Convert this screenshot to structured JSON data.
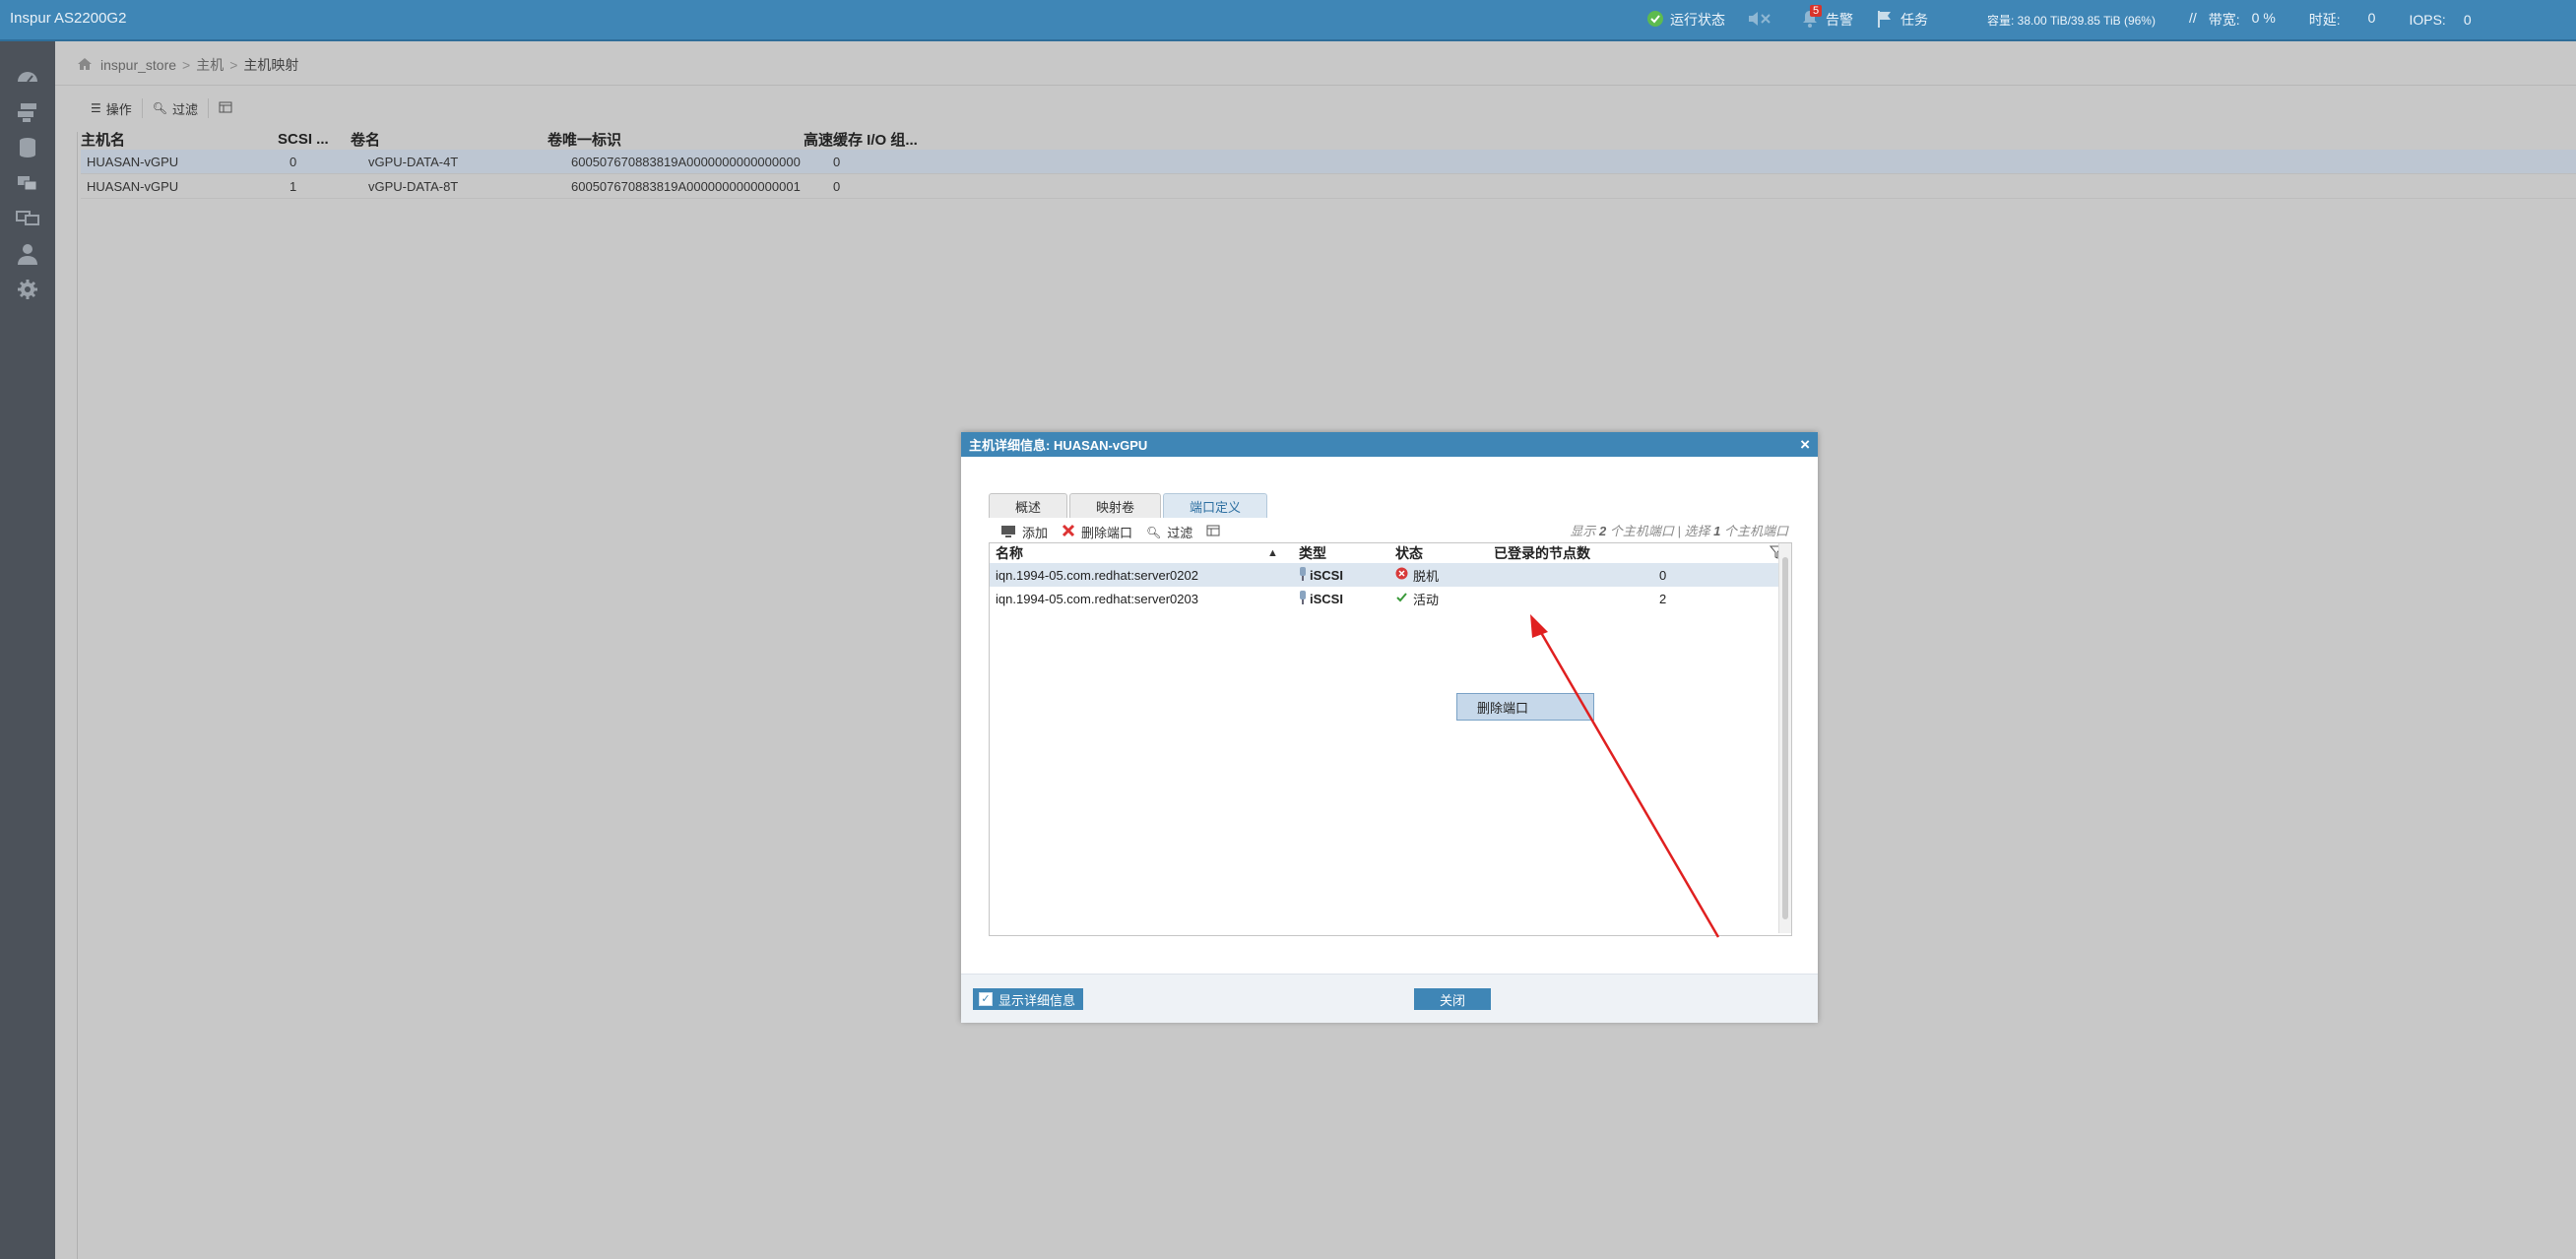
{
  "app": {
    "title": "Inspur AS2200G2"
  },
  "topbar": {
    "run_status": "运行状态",
    "alarm_count": "5",
    "alarm_label": "告警",
    "task_label": "任务",
    "capacity": "容量: 38.00 TiB/39.85 TiB (96%)",
    "bandwidth_label": "带宽:",
    "bandwidth_value": "0 %",
    "latency_label": "时延:",
    "latency_value": "0",
    "iops_label": "IOPS:",
    "iops_value": "0"
  },
  "breadcrumb": [
    "inspur_store",
    "主机",
    "主机映射"
  ],
  "toolbar": {
    "actions": "操作",
    "filter": "过滤"
  },
  "grid": {
    "headers": [
      "主机名",
      "SCSI ...",
      "卷名",
      "卷唯一标识",
      "高速缓存 I/O 组..."
    ],
    "rows": [
      [
        "HUASAN-vGPU",
        "0",
        "vGPU-DATA-4T",
        "600507670883819A0000000000000000",
        "0"
      ],
      [
        "HUASAN-vGPU",
        "1",
        "vGPU-DATA-8T",
        "600507670883819A0000000000000001",
        "0"
      ]
    ]
  },
  "modal": {
    "title": "主机详细信息: HUASAN-vGPU",
    "tabs": [
      "概述",
      "映射卷",
      "端口定义"
    ],
    "toolbar": {
      "add": "添加",
      "delete_port": "删除端口",
      "filter": "过滤"
    },
    "summary_prefix": "显示",
    "summary_count": "2",
    "summary_mid": "个主机端口 | 选择",
    "summary_sel": "1",
    "summary_suffix": "个主机端口",
    "headers": [
      "名称",
      "类型",
      "状态",
      "已登录的节点数"
    ],
    "rows": [
      {
        "name": "iqn.1994-05.com.redhat:server0202",
        "type": "iSCSI",
        "status": "脱机",
        "nodes": "0"
      },
      {
        "name": "iqn.1994-05.com.redhat:server0203",
        "type": "iSCSI",
        "status": "活动",
        "nodes": "2"
      }
    ],
    "context_menu": "删除端口",
    "show_details": "显示详细信息",
    "close": "关闭"
  },
  "colors": {
    "header_blue": "#3f86b6",
    "offline_red": "#d83a3a",
    "active_green": "#3a9a3a",
    "arrow_red": "#e02020"
  }
}
